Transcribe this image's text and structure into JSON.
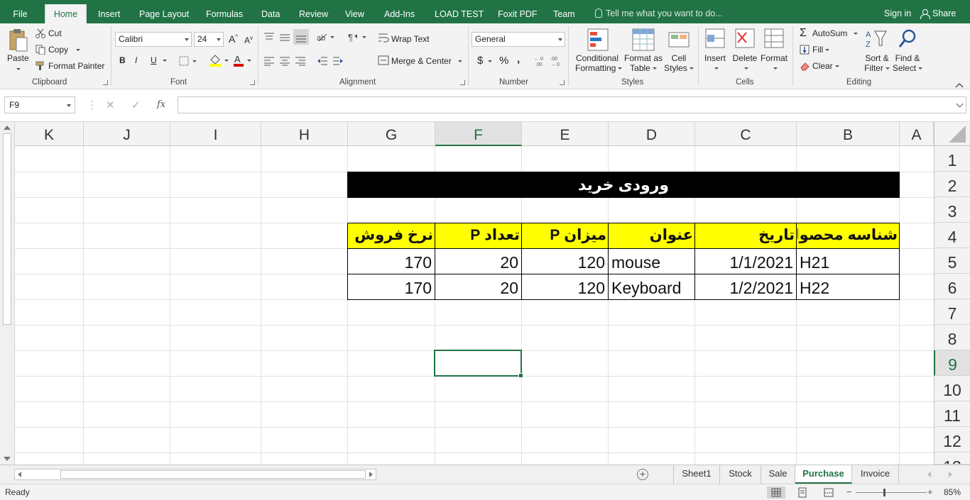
{
  "tabs": [
    "File",
    "Home",
    "Insert",
    "Page Layout",
    "Formulas",
    "Data",
    "Review",
    "View",
    "Add-Ins",
    "LOAD TEST",
    "Foxit PDF",
    "Team"
  ],
  "active_tab": "Home",
  "tell_me": "Tell me what you want to do...",
  "signin": "Sign in",
  "share": "Share",
  "clipboard": {
    "paste": "Paste",
    "cut": "Cut",
    "copy": "Copy",
    "format_painter": "Format Painter",
    "label": "Clipboard"
  },
  "font": {
    "name": "Calibri",
    "size": "24",
    "bold": "B",
    "italic": "I",
    "underline": "U",
    "label": "Font"
  },
  "alignment": {
    "wrap_text": "Wrap Text",
    "merge_center": "Merge & Center",
    "label": "Alignment"
  },
  "number": {
    "format": "General",
    "currency": "$",
    "percent": "%",
    "comma": ",",
    "label": "Number"
  },
  "styles": {
    "conditional": "Conditional",
    "conditional2": "Formatting",
    "format_as": "Format as",
    "format_as2": "Table",
    "cell": "Cell",
    "cell2": "Styles",
    "label": "Styles"
  },
  "cells": {
    "insert": "Insert",
    "delete": "Delete",
    "format": "Format",
    "label": "Cells"
  },
  "editing": {
    "autosum": "AutoSum",
    "fill": "Fill",
    "clear": "Clear",
    "sort": "Sort &",
    "sort2": "Filter",
    "find": "Find &",
    "find2": "Select",
    "label": "Editing"
  },
  "formula_bar": {
    "name_box": "F9",
    "fx": "fx",
    "formula": ""
  },
  "columns": [
    "K",
    "J",
    "I",
    "H",
    "G",
    "F",
    "E",
    "D",
    "C",
    "B",
    "A"
  ],
  "selected_column": "F",
  "rows": [
    "1",
    "2",
    "3",
    "4",
    "5",
    "6",
    "7",
    "8",
    "9",
    "10",
    "11",
    "12"
  ],
  "selected_row": "9",
  "sheet": {
    "title": "ورودی خرید",
    "headers": [
      "نرخ فروش",
      "تعداد P",
      "میزان P",
      "عنوان",
      "تاریخ",
      "شناسه محصول"
    ],
    "data": [
      [
        "170",
        "20",
        "120",
        "mouse",
        "1/1/2021",
        "H21"
      ],
      [
        "170",
        "20",
        "120",
        "Keyboard",
        "1/2/2021",
        "H22"
      ]
    ]
  },
  "sheet_tabs": [
    "Sheet1",
    "Stock",
    "Sale",
    "Purchase",
    "Invoice"
  ],
  "active_sheet": "Purchase",
  "status": {
    "ready": "Ready",
    "zoom": "85%"
  },
  "colors": {
    "excel_green": "#217346",
    "header_fill": "#ffff00",
    "title_fill": "#000000"
  }
}
